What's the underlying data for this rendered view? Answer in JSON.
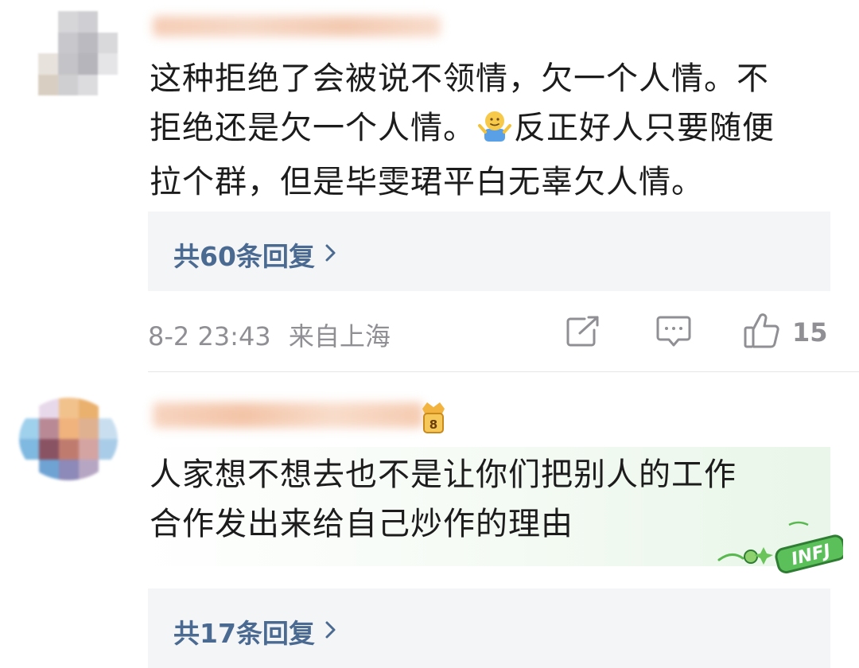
{
  "comments": [
    {
      "text_lines": [
        "这种拒绝了会被说不领情，欠一个人情。不",
        "拒绝还是欠一个人情。",
        "反正好人只要随便",
        "拉个群，但是毕雯珺平白无辜欠人情。"
      ],
      "emoji": "shrug-emoji",
      "reply_label": "共60条回复",
      "time": "8-2 23:43",
      "location": "来自上海",
      "like_count": "15"
    },
    {
      "text_lines": [
        "人家想不想去也不是让你们把别人的工作",
        "合作发出来给自己炒作的理由"
      ],
      "badge": "INFJ",
      "reply_label": "共17条回复"
    }
  ],
  "colors": {
    "link": "#4b6a91",
    "meta": "#8f8f94",
    "text": "#1c1c1c",
    "reply_bg": "#f4f5f6"
  }
}
